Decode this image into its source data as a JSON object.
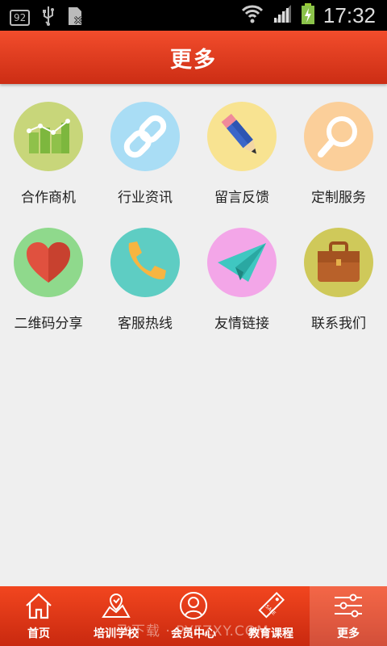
{
  "statusbar": {
    "badge": "92",
    "time": "17:32"
  },
  "header": {
    "title": "更多"
  },
  "grid": [
    {
      "label": "合作商机",
      "icon": "bar-chart-icon",
      "color": "#c8d67a"
    },
    {
      "label": "行业资讯",
      "icon": "link-icon",
      "color": "#a9ddf5"
    },
    {
      "label": "留言反馈",
      "icon": "pencil-icon",
      "color": "#f8e391"
    },
    {
      "label": "定制服务",
      "icon": "magnifier-icon",
      "color": "#fbcf9a"
    },
    {
      "label": "二维码分享",
      "icon": "heart-icon",
      "color": "#8fd98c"
    },
    {
      "label": "客服热线",
      "icon": "phone-icon",
      "color": "#5ecdc3"
    },
    {
      "label": "友情链接",
      "icon": "paper-plane-icon",
      "color": "#f3a6e8"
    },
    {
      "label": "联系我们",
      "icon": "briefcase-icon",
      "color": "#cfc95a"
    }
  ],
  "tabs": [
    {
      "label": "首页",
      "icon": "home-icon"
    },
    {
      "label": "培训学校",
      "icon": "map-icon"
    },
    {
      "label": "会员中心",
      "icon": "user-icon"
    },
    {
      "label": "教育课程",
      "icon": "sale-tag-icon"
    },
    {
      "label": "更多",
      "icon": "settings-sliders-icon",
      "active": true
    }
  ],
  "watermark": "飞下载 · PYFZXY.COM"
}
